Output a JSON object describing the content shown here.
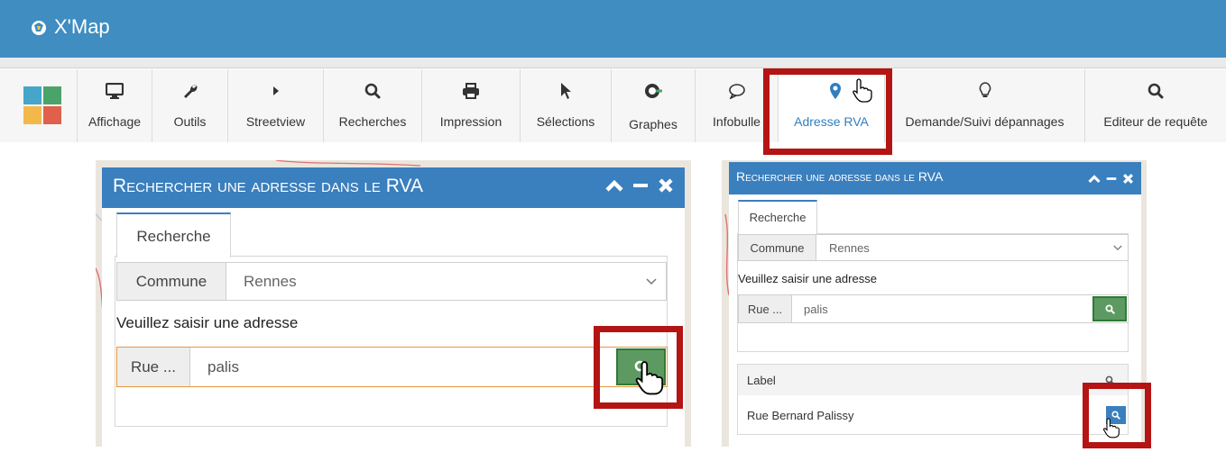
{
  "app": {
    "title": "X'Map"
  },
  "toolbar": {
    "items": [
      {
        "label": "Affichage",
        "icon": "monitor-icon"
      },
      {
        "label": "Outils",
        "icon": "wrench-icon"
      },
      {
        "label": "Streetview",
        "icon": "play-icon"
      },
      {
        "label": "Recherches",
        "icon": "search-icon"
      },
      {
        "label": "Impression",
        "icon": "printer-icon"
      },
      {
        "label": "Sélections",
        "icon": "pointer-icon"
      },
      {
        "label": "Graphes",
        "icon": "compass-icon"
      },
      {
        "label": "Infobulle",
        "icon": "speech-bubble-icon"
      },
      {
        "label": "Adresse RVA",
        "icon": "map-marker-icon"
      },
      {
        "label": "Demande/Suivi dépannages",
        "icon": "lightbulb-icon"
      },
      {
        "label": "Editeur de requête",
        "icon": "search-icon"
      }
    ],
    "active": "Adresse RVA"
  },
  "panel_large": {
    "title": "Rechercher une adresse dans le RVA",
    "tab": "Recherche",
    "commune_label": "Commune",
    "commune_value": "Rennes",
    "prompt": "Veuillez saisir une adresse",
    "street_prefix": "Rue ...",
    "street_value": "palis"
  },
  "panel_small": {
    "title": "Rechercher une adresse dans le RVA",
    "tab": "Recherche",
    "commune_label": "Commune",
    "commune_value": "Rennes",
    "prompt": "Veuillez saisir une adresse",
    "street_prefix": "Rue ...",
    "street_value": "palis",
    "results": {
      "header": "Label",
      "rows": [
        "Rue Bernard Palissy"
      ]
    }
  },
  "colors": {
    "header_blue": "#3f8dc1",
    "panel_blue": "#3a7fbe",
    "search_green": "#5c9a62",
    "highlight_red": "#b41414",
    "active_text": "#2f7fc0"
  }
}
